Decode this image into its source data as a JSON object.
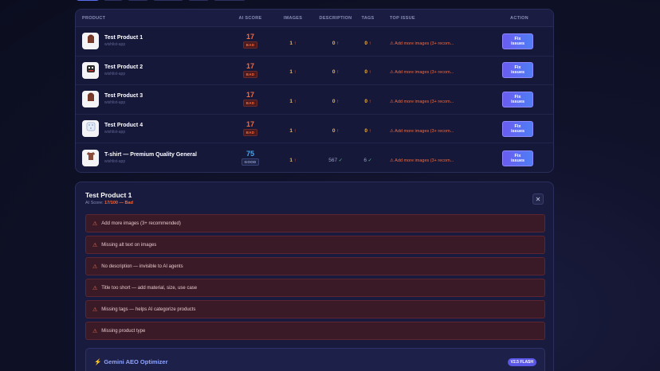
{
  "headers": {
    "product": "PRODUCT",
    "ai_score": "AI SCORE",
    "images": "IMAGES",
    "description": "DESCRIPTION",
    "tags": "TAGS",
    "top_issue": "TOP ISSUE",
    "action": "ACTION"
  },
  "rows": [
    {
      "name": "Test Product 1",
      "store": "wishlist-app",
      "score": "17",
      "badge": "BAD",
      "images": "1",
      "description": "0",
      "tags": "0",
      "issue": "⚠ Add more images (3+ recom...",
      "action": "Fix issues",
      "thumb_icon": "hoodie-icon"
    },
    {
      "name": "Test Product 2",
      "store": "wishlist-app",
      "score": "17",
      "badge": "BAD",
      "images": "1",
      "description": "0",
      "tags": "0",
      "issue": "⚠ Add more images (3+ recom...",
      "action": "Fix issues",
      "thumb_icon": "monster-icon"
    },
    {
      "name": "Test Product 3",
      "store": "wishlist-app",
      "score": "17",
      "badge": "BAD",
      "images": "1",
      "description": "0",
      "tags": "0",
      "issue": "⚠ Add more images (3+ recom...",
      "action": "Fix issues",
      "thumb_icon": "hoodie-icon"
    },
    {
      "name": "Test Product 4",
      "store": "wishlist-app",
      "score": "17",
      "badge": "BAD",
      "images": "1",
      "description": "0",
      "tags": "0",
      "issue": "⚠ Add more images (3+ recom...",
      "action": "Fix issues",
      "thumb_icon": "pattern-icon"
    },
    {
      "name": "T-shirt — Premium Quality General",
      "store": "wishlist-app",
      "score": "75",
      "badge": "GOOD",
      "images": "1",
      "description": "567",
      "tags": "6",
      "issue": "⚠ Add more images (3+ recom...",
      "action": "Fix issues",
      "thumb_icon": "tshirt-icon"
    }
  ],
  "detail": {
    "title": "Test Product 1",
    "score_label": "AI Score:",
    "score_value": "17/100 — Bad",
    "issues": [
      "Add more images (3+ recommended)",
      "Missing alt text on images",
      "No description — invisible to AI agents",
      "Title too short — add material, size, use case",
      "Missing tags — helps AI categorize products",
      "Missing product type"
    ],
    "optimizer_title": "Gemini AEO Optimizer",
    "optimizer_badge": "V2.5 FLASH"
  },
  "colors": {
    "bad": "#f26a3c",
    "good": "#3fa9f5",
    "accent": "#5b57e8"
  }
}
